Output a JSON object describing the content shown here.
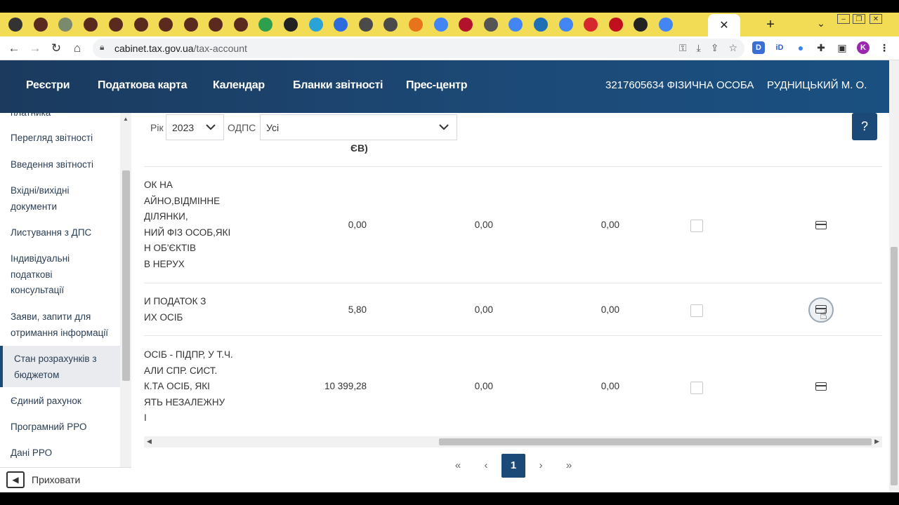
{
  "browser": {
    "tabs": [
      {
        "icon": "calculator-icon",
        "color": "#333333"
      },
      {
        "icon": "tax-service-icon",
        "color": "#5a2a1f"
      },
      {
        "icon": "puzzle-icon",
        "color": "#7a8a6e"
      },
      {
        "icon": "tax-service-icon",
        "color": "#5a2a1f"
      },
      {
        "icon": "tax-service-icon",
        "color": "#5a2a1f"
      },
      {
        "icon": "tax-service-icon",
        "color": "#5a2a1f"
      },
      {
        "icon": "tax-service-icon",
        "color": "#5a2a1f"
      },
      {
        "icon": "tax-service-icon",
        "color": "#5a2a1f"
      },
      {
        "icon": "tax-service-icon",
        "color": "#5a2a1f"
      },
      {
        "icon": "tax-service-icon",
        "color": "#5a2a1f"
      },
      {
        "icon": "drive-icon",
        "color": "#2e9e4f"
      },
      {
        "icon": "slides-icon",
        "color": "#222222"
      },
      {
        "icon": "telegram-icon",
        "color": "#2aa3d9"
      },
      {
        "icon": "zoom-icon",
        "color": "#2d6cdf"
      },
      {
        "icon": "emblem-icon",
        "color": "#4a4a4a"
      },
      {
        "icon": "emblem-icon",
        "color": "#4a4a4a"
      },
      {
        "icon": "box-icon",
        "color": "#e8731a"
      },
      {
        "icon": "google-icon",
        "color": "#4285f4"
      },
      {
        "icon": "ai-icon",
        "color": "#b3122d"
      },
      {
        "icon": "globe-icon",
        "color": "#555555"
      },
      {
        "icon": "google-icon",
        "color": "#4285f4"
      },
      {
        "icon": "camera-icon",
        "color": "#1f6fb5"
      },
      {
        "icon": "google-icon",
        "color": "#4285f4"
      },
      {
        "icon": "s-app-icon",
        "color": "#d8262e"
      },
      {
        "icon": "f-app-icon",
        "color": "#c0101d"
      },
      {
        "icon": "24-icon",
        "color": "#222222"
      },
      {
        "icon": "google-icon",
        "color": "#4285f4"
      }
    ],
    "active_tab_close": "✕",
    "new_tab": "+",
    "url_host": "cabinet.tax.gov.ua",
    "url_path": "/tax-account",
    "profile_initial": "K"
  },
  "header": {
    "menu": [
      "Реєстри",
      "Податкова карта",
      "Календар",
      "Бланки звітності",
      "Прес-центр"
    ],
    "taxpayer": "3217605634 ФІЗИЧНА ОСОБА",
    "user_name": "РУДНИЦЬКИЙ М. О."
  },
  "sidebar": {
    "items": [
      {
        "label": "платника"
      },
      {
        "label": "Перегляд звітності"
      },
      {
        "label": "Введення звітності"
      },
      {
        "label": "Вхідні/вихідні документи"
      },
      {
        "label": "Листування з ДПС"
      },
      {
        "label": "Індивідуальні податкові консультації"
      },
      {
        "label": "Заяви, запити для отримання інформації"
      },
      {
        "label": "Стан розрахунків з бюджетом",
        "active": true
      },
      {
        "label": "Єдиний рахунок"
      },
      {
        "label": "Програмний РРО"
      },
      {
        "label": "Дані РРО"
      }
    ],
    "hide_label": "Приховати"
  },
  "filters": {
    "year_label": "Рік",
    "year_value": "2023",
    "odps_label": "ОДПС",
    "odps_value": "Усі"
  },
  "table": {
    "header_fragment": "ЄВ)",
    "rows": [
      {
        "name_lines": [
          "ОК НА",
          "АЙНО,ВІДМІННЕ",
          "ДІЛЯНКИ,",
          "НИЙ ФІЗ ОСОБ,ЯКІ",
          "Н ОБ'ЄКТІВ",
          "В НЕРУХ"
        ],
        "col1": "0,00",
        "col2": "0,00",
        "col3": "0,00"
      },
      {
        "name_lines": [
          "И ПОДАТОК З",
          "ИХ ОСІБ"
        ],
        "col1": "5,80",
        "col2": "0,00",
        "col3": "0,00"
      },
      {
        "name_lines": [
          "ОСІБ - ПІДПР, У Т.Ч.",
          "АЛИ СПР. СИСТ.",
          "К.ТА ОСІБ, ЯКІ",
          "ЯТЬ НЕЗАЛЕЖНУ",
          "І"
        ],
        "col1": "10 399,28",
        "col2": "0,00",
        "col3": "0,00"
      }
    ]
  },
  "pagination": {
    "first": "«",
    "prev": "‹",
    "current": "1",
    "next": "›",
    "last": "»"
  },
  "help_label": "?"
}
